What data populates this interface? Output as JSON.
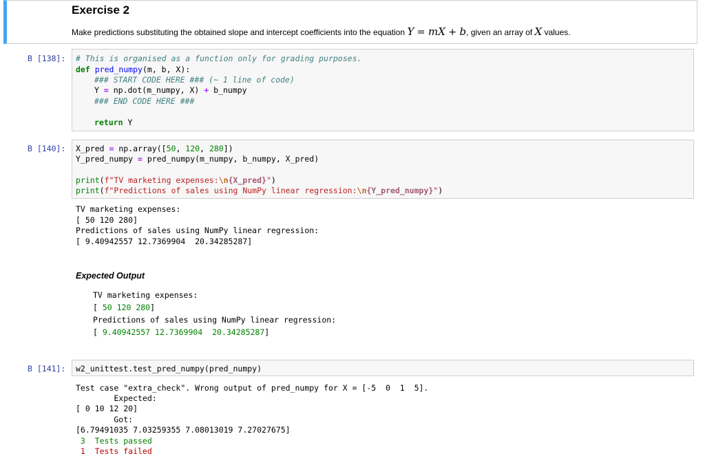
{
  "markdown": {
    "title": "Exercise 2",
    "text_before": "Make predictions substituting the obtained slope and intercept coefficients into the equation ",
    "eq_Y": "Y",
    "eq_eq": " = ",
    "eq_m": "m",
    "eq_X": "X",
    "eq_plus": " + ",
    "eq_b": "b",
    "text_mid": ", given an array of ",
    "eq_X2": "X",
    "text_after": " values."
  },
  "cells": {
    "c138": {
      "prompt": "В [138]:",
      "l1": "# This is organised as a function only for grading purposes.",
      "l2_def": "def",
      "l2_name": "pred_numpy",
      "l2_rest": "(m, b, X):",
      "l3": "### START CODE HERE ### (~ 1 line of code)",
      "l4_a": "Y ",
      "l4_op1": "=",
      "l4_b": " np.dot(m_numpy, X) ",
      "l4_op2": "+",
      "l4_c": " b_numpy",
      "l5": "### END CODE HERE ###",
      "l6_kw": "return",
      "l6_rest": " Y"
    },
    "c140": {
      "prompt": "В [140]:",
      "l1_a": "X_pred ",
      "l1_op": "=",
      "l1_b": " np.array([",
      "l1_n1": "50",
      "l1_sep1": ", ",
      "l1_n2": "120",
      "l1_sep2": ", ",
      "l1_n3": "280",
      "l1_c": "])",
      "l2_a": "Y_pred_numpy ",
      "l2_op": "=",
      "l2_b": " pred_numpy(m_numpy, b_numpy, X_pred)",
      "l3_print": "print",
      "l3_open": "(",
      "l3_str": "f\"TV marketing expenses:",
      "l3_esc": "\\n",
      "l3_interp": "{X_pred}",
      "l3_end": "\"",
      "l3_close": ")",
      "l4_print": "print",
      "l4_open": "(",
      "l4_str": "f\"Predictions of sales using NumPy linear regression:",
      "l4_esc": "\\n",
      "l4_interp": "{Y_pred_numpy}",
      "l4_end": "\"",
      "l4_close": ")",
      "out1": "TV marketing expenses:",
      "out2": "[ 50 120 280]",
      "out3": "Predictions of sales using NumPy linear regression:",
      "out4": "[ 9.40942557 12.7369904  20.34285287]"
    },
    "expected": {
      "title": "Expected Output",
      "l1": "TV marketing expenses:",
      "l2_open": "[ ",
      "l2_val": "50 120 280",
      "l2_close": "]",
      "l3": "Predictions of sales using NumPy linear regression:",
      "l4_open": "[ ",
      "l4_val": "9.40942557 12.7369904  20.34285287",
      "l4_close": "]"
    },
    "c141": {
      "prompt": "В [141]:",
      "code": "w2_unittest.test_pred_numpy(pred_numpy)",
      "out1": "Test case \"extra_check\". Wrong output of pred_numpy for X = [-5  0  1  5].",
      "out2": "        Expected:",
      "out3": "[ 0 10 12 20]",
      "out4": "        Got:",
      "out5": "[6.79491035 7.03259355 7.08013019 7.27027675]",
      "out6": " 3  Tests passed",
      "out7": " 1  Tests failed"
    }
  },
  "colors": {
    "prompt": "#303f9f",
    "selected_border": "#42a5f5",
    "passed": "#008000",
    "failed": "#c00000"
  }
}
